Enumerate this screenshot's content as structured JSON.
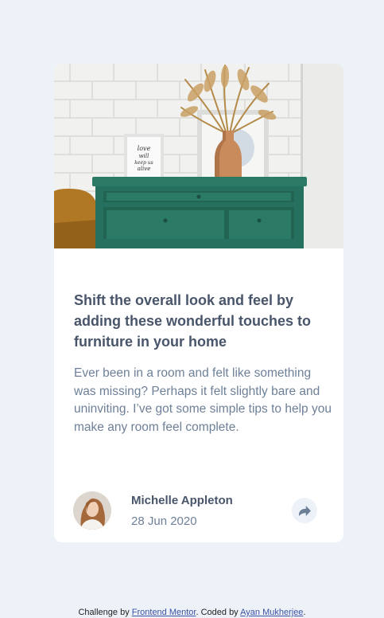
{
  "article": {
    "title": "Shift the overall look and feel by adding these wonderful touches to furniture in your home",
    "description": "Ever been in a room and felt like something was missing? Perhaps it felt slightly bare and uninviting. I’ve got some simple tips to help you make any room feel complete.",
    "image_alt": "drawers",
    "frame_text": [
      "love",
      "will",
      "keep us",
      "alive"
    ]
  },
  "author": {
    "name": "Michelle Appleton",
    "date": "28 Jun 2020",
    "avatar_alt": "Michelle Appleton"
  },
  "share": {
    "icon": "share-icon"
  },
  "footer": {
    "prefix": "Challenge by ",
    "link1": "Frontend Mentor",
    "middle": ". Coded by ",
    "link2": "Ayan Mukherjee",
    "suffix": "."
  },
  "colors": {
    "background": "#ecf2f8",
    "card": "#ffffff",
    "title": "#48556a",
    "body_text": "#6e8098",
    "link": "#3e52a3",
    "dresser_green": "#25705e"
  }
}
